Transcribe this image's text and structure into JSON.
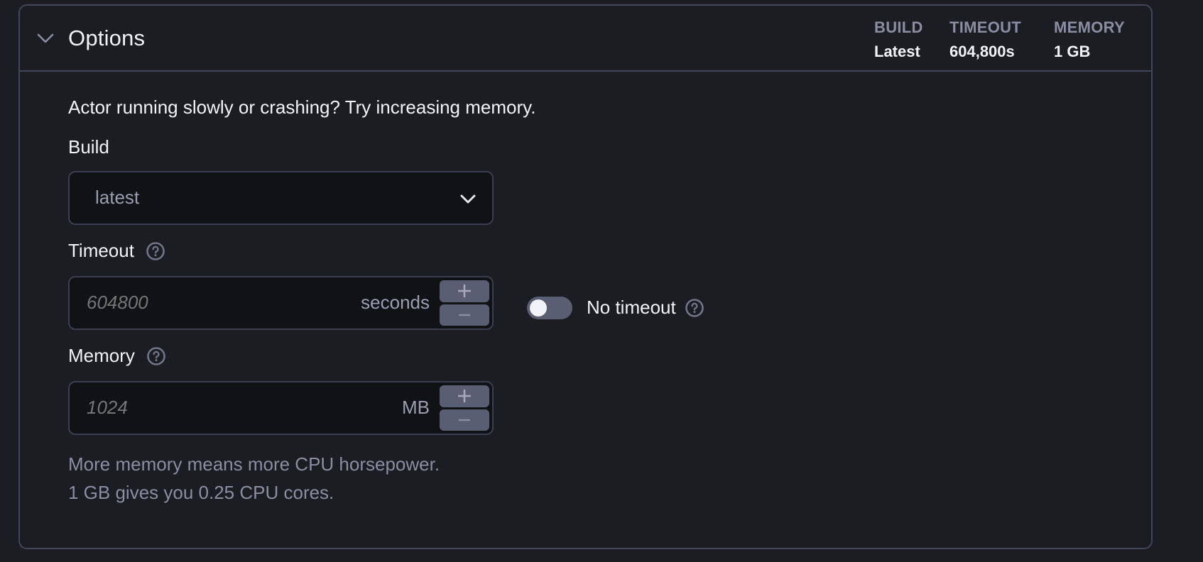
{
  "panel": {
    "title": "Options",
    "summary": [
      {
        "label": "BUILD",
        "value": "Latest"
      },
      {
        "label": "TIMEOUT",
        "value": "604,800s"
      },
      {
        "label": "MEMORY",
        "value": "1 GB"
      }
    ]
  },
  "hint": "Actor running slowly or crashing? Try increasing memory.",
  "build": {
    "label": "Build",
    "selected": "latest"
  },
  "timeout": {
    "label": "Timeout",
    "placeholder": "604800",
    "unit": "seconds",
    "no_timeout_label": "No timeout",
    "no_timeout_enabled": false
  },
  "memory": {
    "label": "Memory",
    "placeholder": "1024",
    "unit": "MB",
    "help_line1": "More memory means more CPU horsepower.",
    "help_line2": "1 GB gives you 0.25 CPU cores."
  },
  "icons": {
    "collapse": "chevron-down-icon",
    "help": "question-circle-icon",
    "increment": "plus-icon",
    "decrement": "minus-icon"
  },
  "colors": {
    "background": "#1c1d22",
    "border": "#42465a",
    "input_bg": "#111216",
    "muted_text": "#8a8ea3",
    "stepper_bg": "#5a5e72"
  }
}
